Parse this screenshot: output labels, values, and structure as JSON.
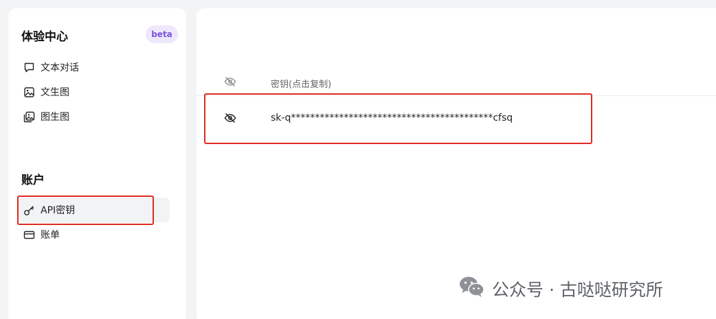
{
  "sidebar": {
    "experience_title": "体验中心",
    "beta_badge": "beta",
    "experience_items": [
      {
        "label": "文本对话",
        "icon": "chat-bubble-icon"
      },
      {
        "label": "文生图",
        "icon": "image-icon"
      },
      {
        "label": "图生图",
        "icon": "images-icon"
      }
    ],
    "account_title": "账户",
    "account_items": [
      {
        "label": "API密钥",
        "icon": "key-icon",
        "active": true
      },
      {
        "label": "账单",
        "icon": "credit-card-icon",
        "active": false
      }
    ]
  },
  "main": {
    "table": {
      "header_icon": "eye-off-icon",
      "header_label": "密钥(点击复制)",
      "rows": [
        {
          "icon": "eye-off-icon",
          "key": "sk-q******************************************cfsq"
        }
      ]
    }
  },
  "watermark": {
    "text": "公众号 · 古哒哒研究所",
    "icon": "wechat-icon"
  },
  "colors": {
    "highlight": "#e0291f",
    "beta_bg": "#ede8fb",
    "beta_text": "#7a55d6"
  }
}
